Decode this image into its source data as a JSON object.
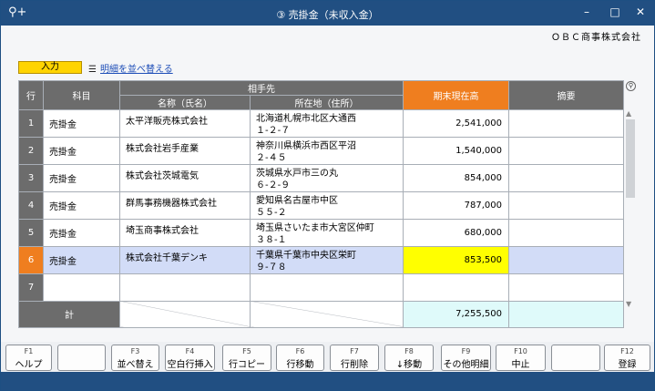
{
  "window": {
    "title": "③ 売掛金（未収入金）",
    "icon": "search-plus-icon",
    "buttons": {
      "minimize": "–",
      "maximize": "□",
      "close": "✕"
    }
  },
  "company": "ＯＢＣ商事株式会社",
  "mode_label": "入力",
  "sort_link": "明細を並べ替える",
  "headers": {
    "row": "行",
    "account": "科目",
    "partner": "相手先",
    "name": "名称（氏名）",
    "address": "所在地（住所）",
    "balance": "期末現在高",
    "memo": "摘要"
  },
  "rows": [
    {
      "no": "1",
      "account": "売掛金",
      "name": "太平洋販売株式会社",
      "addr1": "北海道札幌市北区大通西",
      "addr2": "１-２-７",
      "amount": "2,541,000",
      "memo": ""
    },
    {
      "no": "2",
      "account": "売掛金",
      "name": "株式会社岩手産業",
      "addr1": "神奈川県横浜市西区平沼",
      "addr2": "２-４５",
      "amount": "1,540,000",
      "memo": ""
    },
    {
      "no": "3",
      "account": "売掛金",
      "name": "株式会社茨城電気",
      "addr1": "茨城県水戸市三の丸",
      "addr2": "６-２-９",
      "amount": "854,000",
      "memo": ""
    },
    {
      "no": "4",
      "account": "売掛金",
      "name": "群馬事務機器株式会社",
      "addr1": "愛知県名古屋市中区",
      "addr2": "５５-２",
      "amount": "787,000",
      "memo": ""
    },
    {
      "no": "5",
      "account": "売掛金",
      "name": "埼玉商事株式会社",
      "addr1": "埼玉県さいたま市大宮区仲町",
      "addr2": "３８-１",
      "amount": "680,000",
      "memo": ""
    },
    {
      "no": "6",
      "account": "売掛金",
      "name": "株式会社千葉デンキ",
      "addr1": "千葉県千葉市中央区栄町",
      "addr2": "９-７８",
      "amount": "853,500",
      "memo": ""
    },
    {
      "no": "7",
      "account": "",
      "name": "",
      "addr1": "",
      "addr2": "",
      "amount": "",
      "memo": ""
    }
  ],
  "total": {
    "label": "計",
    "amount": "7,255,500"
  },
  "fkeys": [
    {
      "num": "F1",
      "label": "ヘルプ"
    },
    {
      "num": "",
      "label": ""
    },
    {
      "num": "F3",
      "label": "並べ替え"
    },
    {
      "num": "F4",
      "label": "空白行挿入"
    },
    {
      "num": "F5",
      "label": "行コピー"
    },
    {
      "num": "F6",
      "label": "行移動"
    },
    {
      "num": "F7",
      "label": "行削除"
    },
    {
      "num": "F8",
      "label": "↓移動"
    },
    {
      "num": "F9",
      "label": "その他明細"
    },
    {
      "num": "F10",
      "label": "中止"
    },
    {
      "num": "",
      "label": ""
    },
    {
      "num": "F12",
      "label": "登録"
    }
  ],
  "colors": {
    "titlebar": "#214f82",
    "selected_row": "#d2dcf7",
    "highlight_amount": "#ffff00",
    "header_accent": "#ef7e1f",
    "mode_badge": "#ffd400"
  }
}
